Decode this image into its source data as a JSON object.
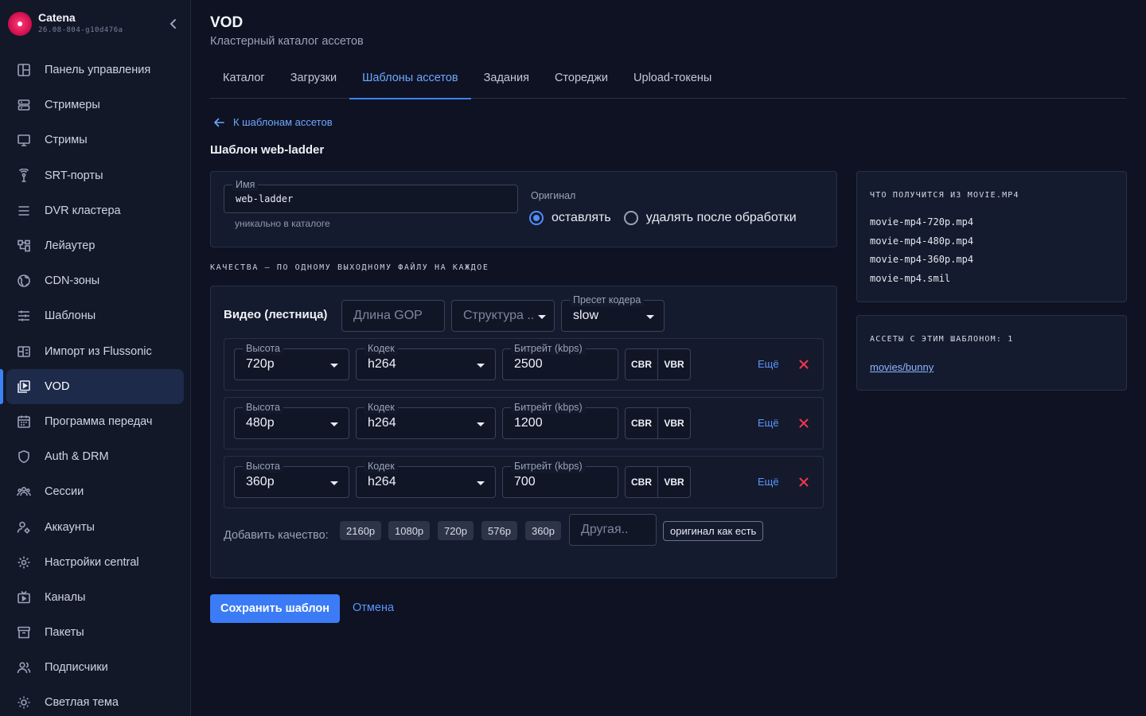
{
  "brand": {
    "name": "Catena",
    "version": "26.08-804-g10d476a"
  },
  "sidebar": {
    "items": [
      {
        "label": "Панель управления",
        "icon": "dashboard-icon"
      },
      {
        "label": "Стримеры",
        "icon": "server-icon"
      },
      {
        "label": "Стримы",
        "icon": "monitor-icon"
      },
      {
        "label": "SRT-порты",
        "icon": "broadcast-icon"
      },
      {
        "label": "DVR кластера",
        "icon": "storage-icon"
      },
      {
        "label": "Лейаутер",
        "icon": "layout-icon"
      },
      {
        "label": "CDN-зоны",
        "icon": "globe-icon"
      },
      {
        "label": "Шаблоны",
        "icon": "sliders-icon"
      },
      {
        "label": "Импорт из Flussonic",
        "icon": "import-icon"
      },
      {
        "label": "VOD",
        "icon": "vod-icon",
        "active": true
      },
      {
        "label": "Программа передач",
        "icon": "calendar-icon"
      },
      {
        "label": "Auth & DRM",
        "icon": "shield-icon"
      },
      {
        "label": "Сессии",
        "icon": "users-icon"
      },
      {
        "label": "Аккаунты",
        "icon": "account-icon"
      },
      {
        "label": "Настройки central",
        "icon": "gear-icon"
      },
      {
        "label": "Каналы",
        "icon": "tv-icon"
      },
      {
        "label": "Пакеты",
        "icon": "package-icon"
      },
      {
        "label": "Подписчики",
        "icon": "subscribers-icon"
      },
      {
        "label": "Светлая тема",
        "icon": "sun-icon"
      }
    ]
  },
  "header": {
    "title": "VOD",
    "subtitle": "Кластерный каталог ассетов"
  },
  "tabs": [
    {
      "label": "Каталог"
    },
    {
      "label": "Загрузки"
    },
    {
      "label": "Шаблоны ассетов",
      "active": true
    },
    {
      "label": "Задания"
    },
    {
      "label": "Стореджи"
    },
    {
      "label": "Upload-токены"
    }
  ],
  "back_link": "К шаблонам ассетов",
  "template_title": "Шаблон web-ladder",
  "name_field": {
    "label": "Имя",
    "value": "web-ladder",
    "helper": "уникально в каталоге"
  },
  "original": {
    "label": "Оригинал",
    "options": [
      "оставлять",
      "удалять после обработки"
    ],
    "selected": "оставлять"
  },
  "qualities_caption": "КАЧЕСТВА — ПО ОДНОМУ ВЫХОДНОМУ ФАЙЛУ НА КАЖДОЕ",
  "video": {
    "title": "Видео (лестница)",
    "gop_placeholder": "Длина GOP",
    "structure_placeholder": "Структура ..",
    "preset": {
      "label": "Пресет кодера",
      "value": "slow"
    }
  },
  "row_labels": {
    "height": "Высота",
    "codec": "Кодек",
    "bitrate": "Битрейт (kbps)",
    "cbr": "CBR",
    "vbr": "VBR",
    "more": "Ещё"
  },
  "rows": [
    {
      "height": "720p",
      "codec": "h264",
      "bitrate": "2500"
    },
    {
      "height": "480p",
      "codec": "h264",
      "bitrate": "1200"
    },
    {
      "height": "360p",
      "codec": "h264",
      "bitrate": "700"
    }
  ],
  "add_quality": {
    "label": "Добавить качество:",
    "chips": [
      "2160p",
      "1080p",
      "720p",
      "576p",
      "360p"
    ],
    "other_placeholder": "Другая..",
    "original_button": "оригинал как есть"
  },
  "actions": {
    "save": "Сохранить шаблон",
    "cancel": "Отмена"
  },
  "output_panel": {
    "title": "ЧТО ПОЛУЧИТСЯ ИЗ MOVIE.MP4",
    "files": [
      "movie-mp4-720p.mp4",
      "movie-mp4-480p.mp4",
      "movie-mp4-360p.mp4",
      "movie-mp4.smil"
    ]
  },
  "assets_panel": {
    "title": "АССЕТЫ С ЭТИМ ШАБЛОНОМ: 1",
    "link": "movies/bunny"
  },
  "colors": {
    "accent": "#3b82f6",
    "background": "#0e1222",
    "danger": "#f0374f"
  }
}
